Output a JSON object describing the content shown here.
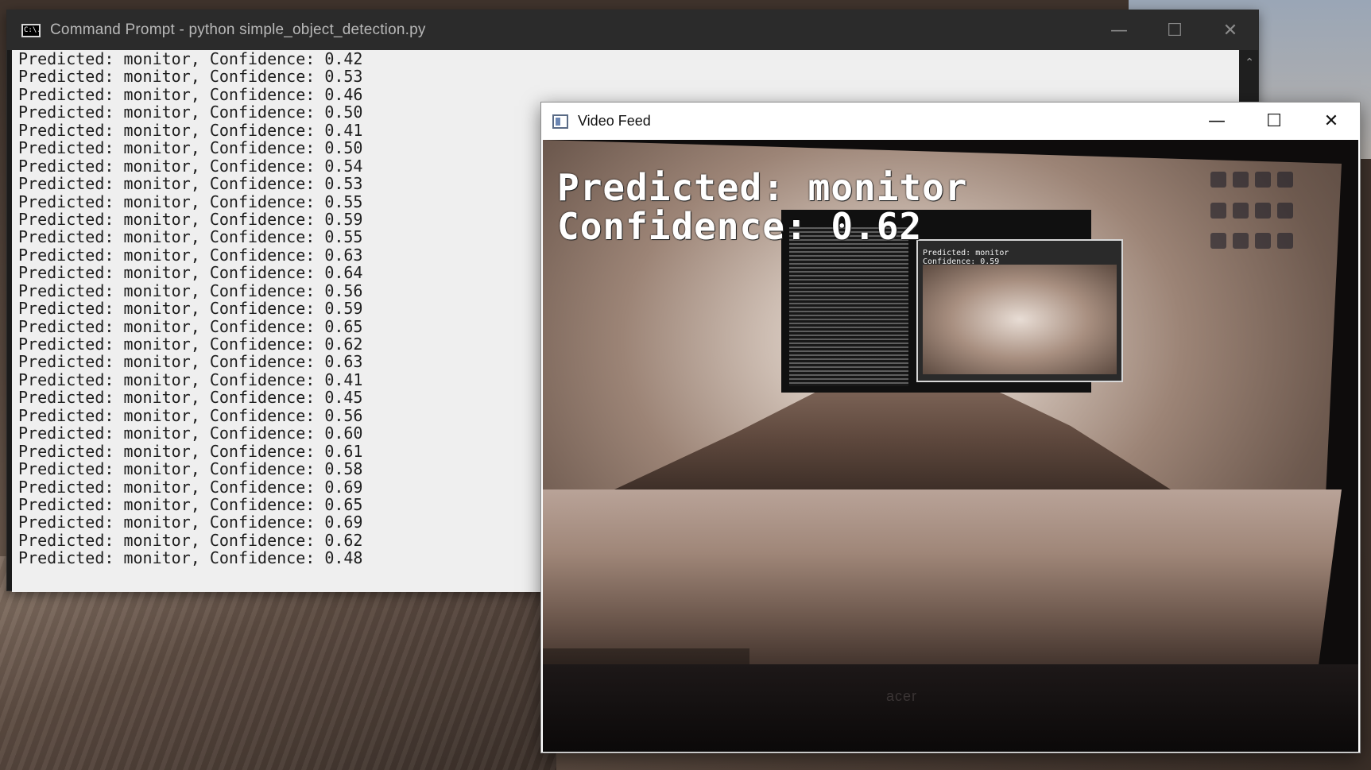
{
  "cmd_window": {
    "title": "Command Prompt - python  simple_object_detection.py",
    "icon_text": "C:\\.",
    "controls": {
      "minimize": "—",
      "maximize": "☐",
      "close": "✕"
    },
    "lines": [
      "Predicted: monitor, Confidence: 0.42",
      "Predicted: monitor, Confidence: 0.53",
      "Predicted: monitor, Confidence: 0.46",
      "Predicted: monitor, Confidence: 0.50",
      "Predicted: monitor, Confidence: 0.41",
      "Predicted: monitor, Confidence: 0.50",
      "Predicted: monitor, Confidence: 0.54",
      "Predicted: monitor, Confidence: 0.53",
      "Predicted: monitor, Confidence: 0.55",
      "Predicted: monitor, Confidence: 0.59",
      "Predicted: monitor, Confidence: 0.55",
      "Predicted: monitor, Confidence: 0.63",
      "Predicted: monitor, Confidence: 0.64",
      "Predicted: monitor, Confidence: 0.56",
      "Predicted: monitor, Confidence: 0.59",
      "Predicted: monitor, Confidence: 0.65",
      "Predicted: monitor, Confidence: 0.62",
      "Predicted: monitor, Confidence: 0.63",
      "Predicted: monitor, Confidence: 0.41",
      "Predicted: monitor, Confidence: 0.45",
      "Predicted: monitor, Confidence: 0.56",
      "Predicted: monitor, Confidence: 0.60",
      "Predicted: monitor, Confidence: 0.61",
      "Predicted: monitor, Confidence: 0.58",
      "Predicted: monitor, Confidence: 0.69",
      "Predicted: monitor, Confidence: 0.65",
      "Predicted: monitor, Confidence: 0.69",
      "Predicted: monitor, Confidence: 0.62",
      "Predicted: monitor, Confidence: 0.48"
    ]
  },
  "video_window": {
    "title": "Video Feed",
    "controls": {
      "minimize": "—",
      "maximize": "☐",
      "close": "✕"
    },
    "overlay_line1": "Predicted: monitor",
    "overlay_line2": "Confidence: 0.62",
    "inner_feed_text": "Predicted: monitor\nConfidence: 0.59",
    "brand": "acer"
  },
  "colors": {
    "cmd_background": "#efefef",
    "cmd_text": "#1e1e1e",
    "cmd_titlebar": "#2b2b2b",
    "overlay_text": "#ffffff"
  }
}
